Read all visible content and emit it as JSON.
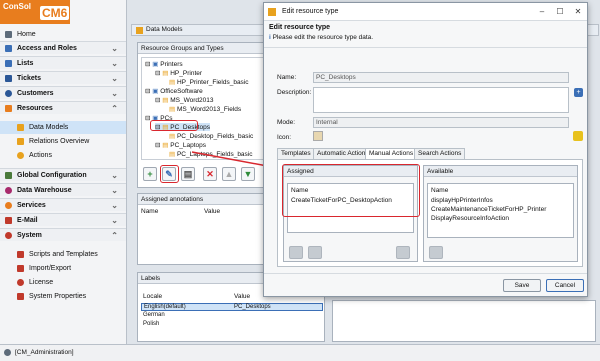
{
  "logo": {
    "line1": "ConSol",
    "line2": "CM6"
  },
  "sidebar": {
    "home": "Home",
    "sections": [
      {
        "label": "Access and Roles"
      },
      {
        "label": "Lists"
      },
      {
        "label": "Tickets"
      },
      {
        "label": "Customers"
      },
      {
        "label": "Resources"
      }
    ],
    "resources_items": [
      "Data Models",
      "Relations Overview",
      "Actions"
    ],
    "sections2": [
      {
        "label": "Global Configuration"
      },
      {
        "label": "Data Warehouse"
      },
      {
        "label": "Services"
      },
      {
        "label": "E-Mail"
      },
      {
        "label": "System"
      }
    ],
    "system_items": [
      "Scripts and Templates",
      "Import/Export",
      "License",
      "System Properties"
    ]
  },
  "topbar": {
    "title": "Data Models"
  },
  "groups_panel": {
    "title": "Resource Groups and Types",
    "tree": [
      {
        "label": "Printers",
        "level": 0
      },
      {
        "label": "HP_Printer",
        "level": 1
      },
      {
        "label": "HP_Printer_Fields_basic",
        "level": 2
      },
      {
        "label": "OfficeSoftware",
        "level": 0
      },
      {
        "label": "MS_Word2013",
        "level": 1
      },
      {
        "label": "MS_Word2013_Fields",
        "level": 2
      },
      {
        "label": "PCs",
        "level": 0
      },
      {
        "label": "PC_Desktops",
        "level": 1
      },
      {
        "label": "PC_Desktop_Fields_basic",
        "level": 2
      },
      {
        "label": "PC_Laptops",
        "level": 1
      },
      {
        "label": "PC_Laptops_Fields_basic",
        "level": 2
      }
    ]
  },
  "annotations": {
    "title": "Assigned annotations",
    "col_name": "Name",
    "col_value": "Value"
  },
  "labels": {
    "title": "Labels",
    "col_locale": "Locale",
    "col_value": "Value",
    "rows": [
      {
        "locale": "English(default)",
        "value": "PC_Desktops"
      },
      {
        "locale": "German",
        "value": ""
      },
      {
        "locale": "Polish",
        "value": ""
      }
    ]
  },
  "statusbar": {
    "user": "[CM_Administration]"
  },
  "dialog": {
    "title": "Edit resource type",
    "heading": "Edit resource type",
    "info": "Please edit the resource type data.",
    "name_label": "Name:",
    "name_value": "PC_Desktops",
    "desc_label": "Description:",
    "mode_label": "Mode:",
    "mode_value": "Internal",
    "icon_label": "Icon:",
    "tabs": [
      "Templates",
      "Automatic Actions",
      "Manual Actions",
      "Search Actions"
    ],
    "assigned_title": "Assigned",
    "available_title": "Available",
    "assigned_col": "Name",
    "available_col": "Name",
    "assigned_rows": [
      "CreateTicketForPC_DesktopAction"
    ],
    "available_rows": [
      "displayHpPrinterInfos",
      "CreateMaintenanceTicketForHP_Printer",
      "DisplayResourceInfoAction"
    ],
    "save": "Save",
    "cancel": "Cancel"
  },
  "colors": {
    "accent": "#e87d1e",
    "highlight": "#d9272e",
    "selection": "#cfe3f7"
  }
}
